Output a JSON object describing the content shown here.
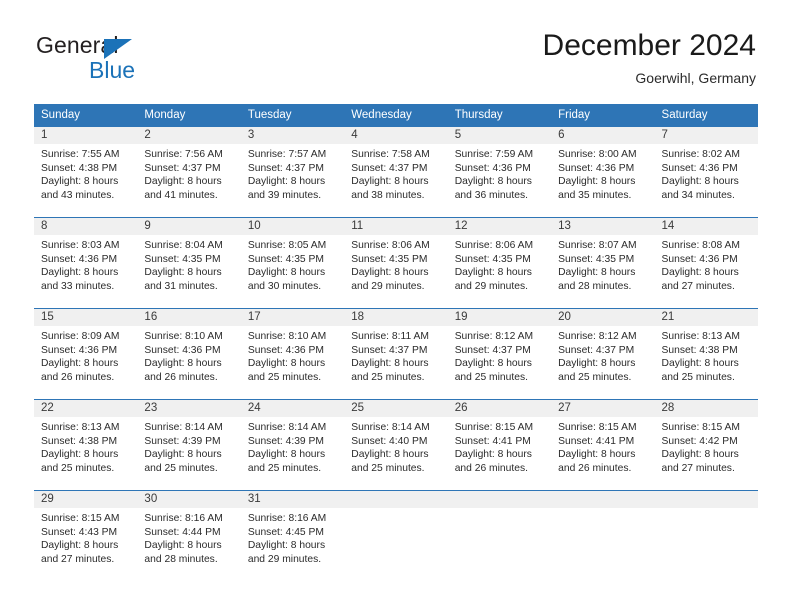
{
  "brand": {
    "name_part1": "General",
    "name_part2": "Blue",
    "accent_color": "#1b72b8",
    "triangle_icon": "triangle-icon"
  },
  "header": {
    "title": "December 2024",
    "location": "Goerwihl, Germany"
  },
  "calendar": {
    "header_background": "#2e75b6",
    "daynum_background": "#f0f0f0",
    "weekdays": [
      "Sunday",
      "Monday",
      "Tuesday",
      "Wednesday",
      "Thursday",
      "Friday",
      "Saturday"
    ],
    "weeks": [
      [
        {
          "day": "1",
          "sunrise": "Sunrise: 7:55 AM",
          "sunset": "Sunset: 4:38 PM",
          "daylight1": "Daylight: 8 hours",
          "daylight2": "and 43 minutes."
        },
        {
          "day": "2",
          "sunrise": "Sunrise: 7:56 AM",
          "sunset": "Sunset: 4:37 PM",
          "daylight1": "Daylight: 8 hours",
          "daylight2": "and 41 minutes."
        },
        {
          "day": "3",
          "sunrise": "Sunrise: 7:57 AM",
          "sunset": "Sunset: 4:37 PM",
          "daylight1": "Daylight: 8 hours",
          "daylight2": "and 39 minutes."
        },
        {
          "day": "4",
          "sunrise": "Sunrise: 7:58 AM",
          "sunset": "Sunset: 4:37 PM",
          "daylight1": "Daylight: 8 hours",
          "daylight2": "and 38 minutes."
        },
        {
          "day": "5",
          "sunrise": "Sunrise: 7:59 AM",
          "sunset": "Sunset: 4:36 PM",
          "daylight1": "Daylight: 8 hours",
          "daylight2": "and 36 minutes."
        },
        {
          "day": "6",
          "sunrise": "Sunrise: 8:00 AM",
          "sunset": "Sunset: 4:36 PM",
          "daylight1": "Daylight: 8 hours",
          "daylight2": "and 35 minutes."
        },
        {
          "day": "7",
          "sunrise": "Sunrise: 8:02 AM",
          "sunset": "Sunset: 4:36 PM",
          "daylight1": "Daylight: 8 hours",
          "daylight2": "and 34 minutes."
        }
      ],
      [
        {
          "day": "8",
          "sunrise": "Sunrise: 8:03 AM",
          "sunset": "Sunset: 4:36 PM",
          "daylight1": "Daylight: 8 hours",
          "daylight2": "and 33 minutes."
        },
        {
          "day": "9",
          "sunrise": "Sunrise: 8:04 AM",
          "sunset": "Sunset: 4:35 PM",
          "daylight1": "Daylight: 8 hours",
          "daylight2": "and 31 minutes."
        },
        {
          "day": "10",
          "sunrise": "Sunrise: 8:05 AM",
          "sunset": "Sunset: 4:35 PM",
          "daylight1": "Daylight: 8 hours",
          "daylight2": "and 30 minutes."
        },
        {
          "day": "11",
          "sunrise": "Sunrise: 8:06 AM",
          "sunset": "Sunset: 4:35 PM",
          "daylight1": "Daylight: 8 hours",
          "daylight2": "and 29 minutes."
        },
        {
          "day": "12",
          "sunrise": "Sunrise: 8:06 AM",
          "sunset": "Sunset: 4:35 PM",
          "daylight1": "Daylight: 8 hours",
          "daylight2": "and 29 minutes."
        },
        {
          "day": "13",
          "sunrise": "Sunrise: 8:07 AM",
          "sunset": "Sunset: 4:35 PM",
          "daylight1": "Daylight: 8 hours",
          "daylight2": "and 28 minutes."
        },
        {
          "day": "14",
          "sunrise": "Sunrise: 8:08 AM",
          "sunset": "Sunset: 4:36 PM",
          "daylight1": "Daylight: 8 hours",
          "daylight2": "and 27 minutes."
        }
      ],
      [
        {
          "day": "15",
          "sunrise": "Sunrise: 8:09 AM",
          "sunset": "Sunset: 4:36 PM",
          "daylight1": "Daylight: 8 hours",
          "daylight2": "and 26 minutes."
        },
        {
          "day": "16",
          "sunrise": "Sunrise: 8:10 AM",
          "sunset": "Sunset: 4:36 PM",
          "daylight1": "Daylight: 8 hours",
          "daylight2": "and 26 minutes."
        },
        {
          "day": "17",
          "sunrise": "Sunrise: 8:10 AM",
          "sunset": "Sunset: 4:36 PM",
          "daylight1": "Daylight: 8 hours",
          "daylight2": "and 25 minutes."
        },
        {
          "day": "18",
          "sunrise": "Sunrise: 8:11 AM",
          "sunset": "Sunset: 4:37 PM",
          "daylight1": "Daylight: 8 hours",
          "daylight2": "and 25 minutes."
        },
        {
          "day": "19",
          "sunrise": "Sunrise: 8:12 AM",
          "sunset": "Sunset: 4:37 PM",
          "daylight1": "Daylight: 8 hours",
          "daylight2": "and 25 minutes."
        },
        {
          "day": "20",
          "sunrise": "Sunrise: 8:12 AM",
          "sunset": "Sunset: 4:37 PM",
          "daylight1": "Daylight: 8 hours",
          "daylight2": "and 25 minutes."
        },
        {
          "day": "21",
          "sunrise": "Sunrise: 8:13 AM",
          "sunset": "Sunset: 4:38 PM",
          "daylight1": "Daylight: 8 hours",
          "daylight2": "and 25 minutes."
        }
      ],
      [
        {
          "day": "22",
          "sunrise": "Sunrise: 8:13 AM",
          "sunset": "Sunset: 4:38 PM",
          "daylight1": "Daylight: 8 hours",
          "daylight2": "and 25 minutes."
        },
        {
          "day": "23",
          "sunrise": "Sunrise: 8:14 AM",
          "sunset": "Sunset: 4:39 PM",
          "daylight1": "Daylight: 8 hours",
          "daylight2": "and 25 minutes."
        },
        {
          "day": "24",
          "sunrise": "Sunrise: 8:14 AM",
          "sunset": "Sunset: 4:39 PM",
          "daylight1": "Daylight: 8 hours",
          "daylight2": "and 25 minutes."
        },
        {
          "day": "25",
          "sunrise": "Sunrise: 8:14 AM",
          "sunset": "Sunset: 4:40 PM",
          "daylight1": "Daylight: 8 hours",
          "daylight2": "and 25 minutes."
        },
        {
          "day": "26",
          "sunrise": "Sunrise: 8:15 AM",
          "sunset": "Sunset: 4:41 PM",
          "daylight1": "Daylight: 8 hours",
          "daylight2": "and 26 minutes."
        },
        {
          "day": "27",
          "sunrise": "Sunrise: 8:15 AM",
          "sunset": "Sunset: 4:41 PM",
          "daylight1": "Daylight: 8 hours",
          "daylight2": "and 26 minutes."
        },
        {
          "day": "28",
          "sunrise": "Sunrise: 8:15 AM",
          "sunset": "Sunset: 4:42 PM",
          "daylight1": "Daylight: 8 hours",
          "daylight2": "and 27 minutes."
        }
      ],
      [
        {
          "day": "29",
          "sunrise": "Sunrise: 8:15 AM",
          "sunset": "Sunset: 4:43 PM",
          "daylight1": "Daylight: 8 hours",
          "daylight2": "and 27 minutes."
        },
        {
          "day": "30",
          "sunrise": "Sunrise: 8:16 AM",
          "sunset": "Sunset: 4:44 PM",
          "daylight1": "Daylight: 8 hours",
          "daylight2": "and 28 minutes."
        },
        {
          "day": "31",
          "sunrise": "Sunrise: 8:16 AM",
          "sunset": "Sunset: 4:45 PM",
          "daylight1": "Daylight: 8 hours",
          "daylight2": "and 29 minutes."
        },
        {
          "day": "",
          "sunrise": "",
          "sunset": "",
          "daylight1": "",
          "daylight2": ""
        },
        {
          "day": "",
          "sunrise": "",
          "sunset": "",
          "daylight1": "",
          "daylight2": ""
        },
        {
          "day": "",
          "sunrise": "",
          "sunset": "",
          "daylight1": "",
          "daylight2": ""
        },
        {
          "day": "",
          "sunrise": "",
          "sunset": "",
          "daylight1": "",
          "daylight2": ""
        }
      ]
    ]
  }
}
